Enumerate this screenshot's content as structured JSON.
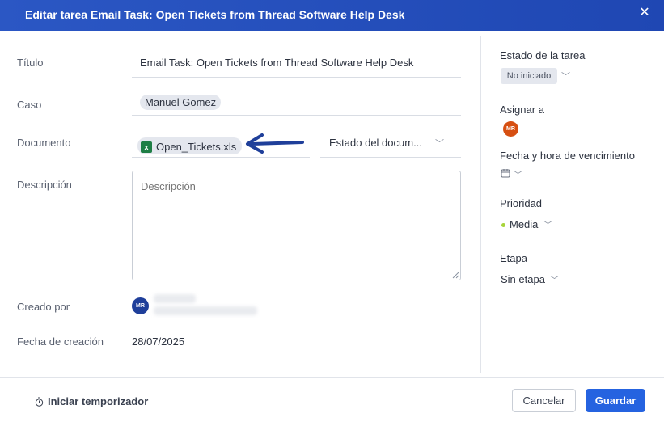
{
  "dialog": {
    "title": "Editar tarea Email Task: Open Tickets from Thread Software Help Desk",
    "close_icon": "close-icon"
  },
  "form": {
    "title_label": "Título",
    "title_value": "Email Task: Open Tickets from Thread Software Help Desk",
    "case_label": "Caso",
    "case_value": "Manuel Gomez",
    "document_label": "Documento",
    "document_file": "Open_Tickets.xls",
    "document_file_icon": "excel-file-icon",
    "document_status_placeholder": "Estado del docum...",
    "description_label": "Descripción",
    "description_placeholder": "Descripción",
    "created_by_label": "Creado por",
    "created_by_initials": "MR",
    "created_date_label": "Fecha de creación",
    "created_date_value": "28/07/2025"
  },
  "side": {
    "task_status_label": "Estado de la tarea",
    "task_status_value": "No iniciado",
    "assign_label": "Asignar a",
    "assignee_initials": "MR",
    "due_label": "Fecha y hora de vencimiento",
    "due_icon": "calendar-icon",
    "priority_label": "Prioridad",
    "priority_value": "Media",
    "priority_color": "#a8d43a",
    "stage_label": "Etapa",
    "stage_value": "Sin etapa"
  },
  "footer": {
    "timer_label": "Iniciar temporizador",
    "timer_icon": "stopwatch-icon",
    "cancel_label": "Cancelar",
    "save_label": "Guardar"
  },
  "colors": {
    "header_bg": "#2b57c4",
    "primary": "#2563e0",
    "annotation_arrow": "#1f3f9a"
  }
}
